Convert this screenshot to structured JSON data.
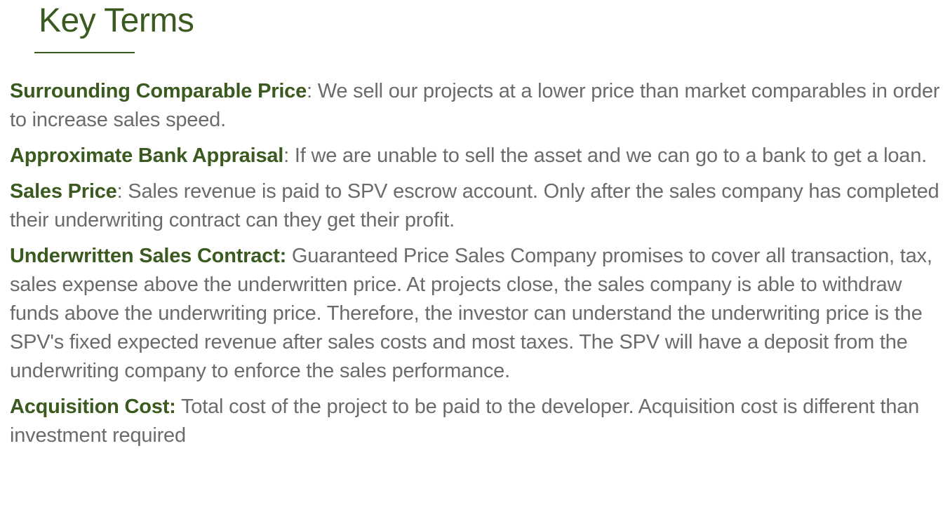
{
  "page": {
    "title": "Key Terms"
  },
  "terms": [
    {
      "name": "Surrounding Comparable Price",
      "separator": ":",
      "definition": " We sell our projects at a lower price than market comparables in order to increase sales speed."
    },
    {
      "name": "Approximate Bank Appraisal",
      "separator": ":",
      "definition": " If we are unable to sell the asset and we can go to a bank to get a loan."
    },
    {
      "name": "Sales Price",
      "separator": ":",
      "definition": " Sales revenue is paid to SPV escrow account.  Only after the sales company has completed their underwriting contract can they get their profit."
    },
    {
      "name": "Underwritten Sales Contract:",
      "separator": "",
      "definition": " Guaranteed Price Sales Company promises to cover all transaction, tax, sales expense above the underwritten price. At projects close, the sales company is able to withdraw funds above the underwriting price. Therefore, the investor can understand the underwriting price is the SPV's fixed expected revenue after sales costs and most taxes. The SPV will have a deposit from the underwriting company to enforce the sales performance."
    },
    {
      "name": "Acquisition Cost:",
      "separator": "",
      "definition": " Total cost of the project to be paid to the developer.   Acquisition cost is different than investment required"
    }
  ],
  "colors": {
    "accent": "#3a5a1f",
    "body_text": "#6b6b6b",
    "background": "#ffffff"
  }
}
